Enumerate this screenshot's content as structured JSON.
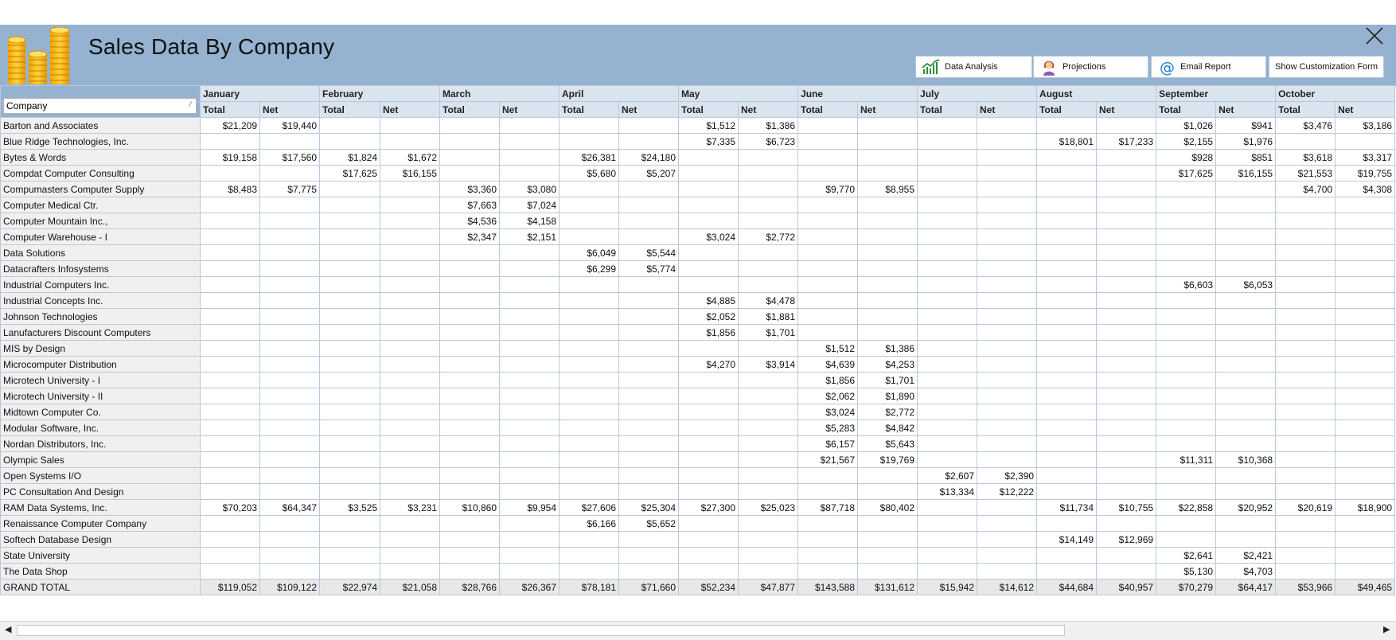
{
  "app": {
    "title": "Sales Data By Company",
    "buttons": {
      "data_analysis": "Data Analysis",
      "projections": "Projections",
      "email_report": "Email Report",
      "customization": "Show Customization Form"
    },
    "icons": {
      "logo": "gold-coins-icon",
      "close": "close-icon",
      "data_analysis": "bar-chart-icon",
      "projections": "person-icon",
      "email": "at-sign-icon"
    },
    "accent_color": "#95b2d0"
  },
  "grid": {
    "filter_label": "Company",
    "months": [
      "January",
      "February",
      "March",
      "April",
      "May",
      "June",
      "July",
      "August",
      "September",
      "October"
    ],
    "sub_total": "Total",
    "sub_net": "Net",
    "rows": [
      {
        "company": "Barton and Associates",
        "cells": [
          "$21,209",
          "$19,440",
          "",
          "",
          "",
          "",
          "",
          "",
          "$1,512",
          "$1,386",
          "",
          "",
          "",
          "",
          "",
          "",
          "$1,026",
          "$941",
          "$3,476",
          "$3,186"
        ]
      },
      {
        "company": "Blue Ridge Technologies, Inc.",
        "cells": [
          "",
          "",
          "",
          "",
          "",
          "",
          "",
          "",
          "$7,335",
          "$6,723",
          "",
          "",
          "",
          "",
          "$18,801",
          "$17,233",
          "$2,155",
          "$1,976",
          "",
          ""
        ]
      },
      {
        "company": "Bytes & Words",
        "cells": [
          "$19,158",
          "$17,560",
          "$1,824",
          "$1,672",
          "",
          "",
          "$26,381",
          "$24,180",
          "",
          "",
          "",
          "",
          "",
          "",
          "",
          "",
          "$928",
          "$851",
          "$3,618",
          "$3,317"
        ]
      },
      {
        "company": "Compdat Computer Consulting",
        "cells": [
          "",
          "",
          "$17,625",
          "$16,155",
          "",
          "",
          "$5,680",
          "$5,207",
          "",
          "",
          "",
          "",
          "",
          "",
          "",
          "",
          "$17,625",
          "$16,155",
          "$21,553",
          "$19,755"
        ]
      },
      {
        "company": "Compumasters Computer Supply",
        "cells": [
          "$8,483",
          "$7,775",
          "",
          "",
          "$3,360",
          "$3,080",
          "",
          "",
          "",
          "",
          "$9,770",
          "$8,955",
          "",
          "",
          "",
          "",
          "",
          "",
          "$4,700",
          "$4,308"
        ]
      },
      {
        "company": "Computer Medical Ctr.",
        "cells": [
          "",
          "",
          "",
          "",
          "$7,663",
          "$7,024",
          "",
          "",
          "",
          "",
          "",
          "",
          "",
          "",
          "",
          "",
          "",
          "",
          "",
          ""
        ]
      },
      {
        "company": "Computer Mountain Inc.,",
        "cells": [
          "",
          "",
          "",
          "",
          "$4,536",
          "$4,158",
          "",
          "",
          "",
          "",
          "",
          "",
          "",
          "",
          "",
          "",
          "",
          "",
          "",
          ""
        ]
      },
      {
        "company": "Computer Warehouse - I",
        "cells": [
          "",
          "",
          "",
          "",
          "$2,347",
          "$2,151",
          "",
          "",
          "$3,024",
          "$2,772",
          "",
          "",
          "",
          "",
          "",
          "",
          "",
          "",
          "",
          ""
        ]
      },
      {
        "company": "Data Solutions",
        "cells": [
          "",
          "",
          "",
          "",
          "",
          "",
          "$6,049",
          "$5,544",
          "",
          "",
          "",
          "",
          "",
          "",
          "",
          "",
          "",
          "",
          "",
          ""
        ]
      },
      {
        "company": "Datacrafters Infosystems",
        "cells": [
          "",
          "",
          "",
          "",
          "",
          "",
          "$6,299",
          "$5,774",
          "",
          "",
          "",
          "",
          "",
          "",
          "",
          "",
          "",
          "",
          "",
          ""
        ]
      },
      {
        "company": "Industrial Computers Inc.",
        "cells": [
          "",
          "",
          "",
          "",
          "",
          "",
          "",
          "",
          "",
          "",
          "",
          "",
          "",
          "",
          "",
          "",
          "$6,603",
          "$6,053",
          "",
          ""
        ]
      },
      {
        "company": "Industrial Concepts Inc.",
        "cells": [
          "",
          "",
          "",
          "",
          "",
          "",
          "",
          "",
          "$4,885",
          "$4,478",
          "",
          "",
          "",
          "",
          "",
          "",
          "",
          "",
          "",
          ""
        ]
      },
      {
        "company": "Johnson Technologies",
        "cells": [
          "",
          "",
          "",
          "",
          "",
          "",
          "",
          "",
          "$2,052",
          "$1,881",
          "",
          "",
          "",
          "",
          "",
          "",
          "",
          "",
          "",
          ""
        ]
      },
      {
        "company": "Lanufacturers Discount Computers",
        "cells": [
          "",
          "",
          "",
          "",
          "",
          "",
          "",
          "",
          "$1,856",
          "$1,701",
          "",
          "",
          "",
          "",
          "",
          "",
          "",
          "",
          "",
          ""
        ]
      },
      {
        "company": "MIS by Design",
        "cells": [
          "",
          "",
          "",
          "",
          "",
          "",
          "",
          "",
          "",
          "",
          "$1,512",
          "$1,386",
          "",
          "",
          "",
          "",
          "",
          "",
          "",
          ""
        ]
      },
      {
        "company": "Microcomputer Distribution",
        "cells": [
          "",
          "",
          "",
          "",
          "",
          "",
          "",
          "",
          "$4,270",
          "$3,914",
          "$4,639",
          "$4,253",
          "",
          "",
          "",
          "",
          "",
          "",
          "",
          ""
        ]
      },
      {
        "company": "Microtech University - I",
        "cells": [
          "",
          "",
          "",
          "",
          "",
          "",
          "",
          "",
          "",
          "",
          "$1,856",
          "$1,701",
          "",
          "",
          "",
          "",
          "",
          "",
          "",
          ""
        ]
      },
      {
        "company": "Microtech University - II",
        "cells": [
          "",
          "",
          "",
          "",
          "",
          "",
          "",
          "",
          "",
          "",
          "$2,062",
          "$1,890",
          "",
          "",
          "",
          "",
          "",
          "",
          "",
          ""
        ]
      },
      {
        "company": "Midtown Computer Co.",
        "cells": [
          "",
          "",
          "",
          "",
          "",
          "",
          "",
          "",
          "",
          "",
          "$3,024",
          "$2,772",
          "",
          "",
          "",
          "",
          "",
          "",
          "",
          ""
        ]
      },
      {
        "company": "Modular Software, Inc.",
        "cells": [
          "",
          "",
          "",
          "",
          "",
          "",
          "",
          "",
          "",
          "",
          "$5,283",
          "$4,842",
          "",
          "",
          "",
          "",
          "",
          "",
          "",
          ""
        ]
      },
      {
        "company": "Nordan Distributors, Inc.",
        "cells": [
          "",
          "",
          "",
          "",
          "",
          "",
          "",
          "",
          "",
          "",
          "$6,157",
          "$5,643",
          "",
          "",
          "",
          "",
          "",
          "",
          "",
          ""
        ]
      },
      {
        "company": "Olympic Sales",
        "cells": [
          "",
          "",
          "",
          "",
          "",
          "",
          "",
          "",
          "",
          "",
          "$21,567",
          "$19,769",
          "",
          "",
          "",
          "",
          "$11,311",
          "$10,368",
          "",
          ""
        ]
      },
      {
        "company": "Open Systems I/O",
        "cells": [
          "",
          "",
          "",
          "",
          "",
          "",
          "",
          "",
          "",
          "",
          "",
          "",
          "$2,607",
          "$2,390",
          "",
          "",
          "",
          "",
          "",
          ""
        ]
      },
      {
        "company": "PC Consultation And Design",
        "cells": [
          "",
          "",
          "",
          "",
          "",
          "",
          "",
          "",
          "",
          "",
          "",
          "",
          "$13,334",
          "$12,222",
          "",
          "",
          "",
          "",
          "",
          ""
        ]
      },
      {
        "company": "RAM Data Systems, Inc.",
        "cells": [
          "$70,203",
          "$64,347",
          "$3,525",
          "$3,231",
          "$10,860",
          "$9,954",
          "$27,606",
          "$25,304",
          "$27,300",
          "$25,023",
          "$87,718",
          "$80,402",
          "",
          "",
          "$11,734",
          "$10,755",
          "$22,858",
          "$20,952",
          "$20,619",
          "$18,900"
        ]
      },
      {
        "company": "Renaissance Computer Company",
        "cells": [
          "",
          "",
          "",
          "",
          "",
          "",
          "$6,166",
          "$5,652",
          "",
          "",
          "",
          "",
          "",
          "",
          "",
          "",
          "",
          "",
          "",
          ""
        ]
      },
      {
        "company": "Softech Database Design",
        "cells": [
          "",
          "",
          "",
          "",
          "",
          "",
          "",
          "",
          "",
          "",
          "",
          "",
          "",
          "",
          "$14,149",
          "$12,969",
          "",
          "",
          "",
          ""
        ]
      },
      {
        "company": "State University",
        "cells": [
          "",
          "",
          "",
          "",
          "",
          "",
          "",
          "",
          "",
          "",
          "",
          "",
          "",
          "",
          "",
          "",
          "$2,641",
          "$2,421",
          "",
          ""
        ]
      },
      {
        "company": "The Data Shop",
        "cells": [
          "",
          "",
          "",
          "",
          "",
          "",
          "",
          "",
          "",
          "",
          "",
          "",
          "",
          "",
          "",
          "",
          "$5,130",
          "$4,703",
          "",
          ""
        ]
      }
    ],
    "grand_total": {
      "company": "GRAND TOTAL",
      "cells": [
        "$119,052",
        "$109,122",
        "$22,974",
        "$21,058",
        "$28,766",
        "$26,367",
        "$78,181",
        "$71,660",
        "$52,234",
        "$47,877",
        "$143,588",
        "$131,612",
        "$15,942",
        "$14,612",
        "$44,684",
        "$40,957",
        "$70,279",
        "$64,417",
        "$53,966",
        "$49,465"
      ]
    }
  }
}
